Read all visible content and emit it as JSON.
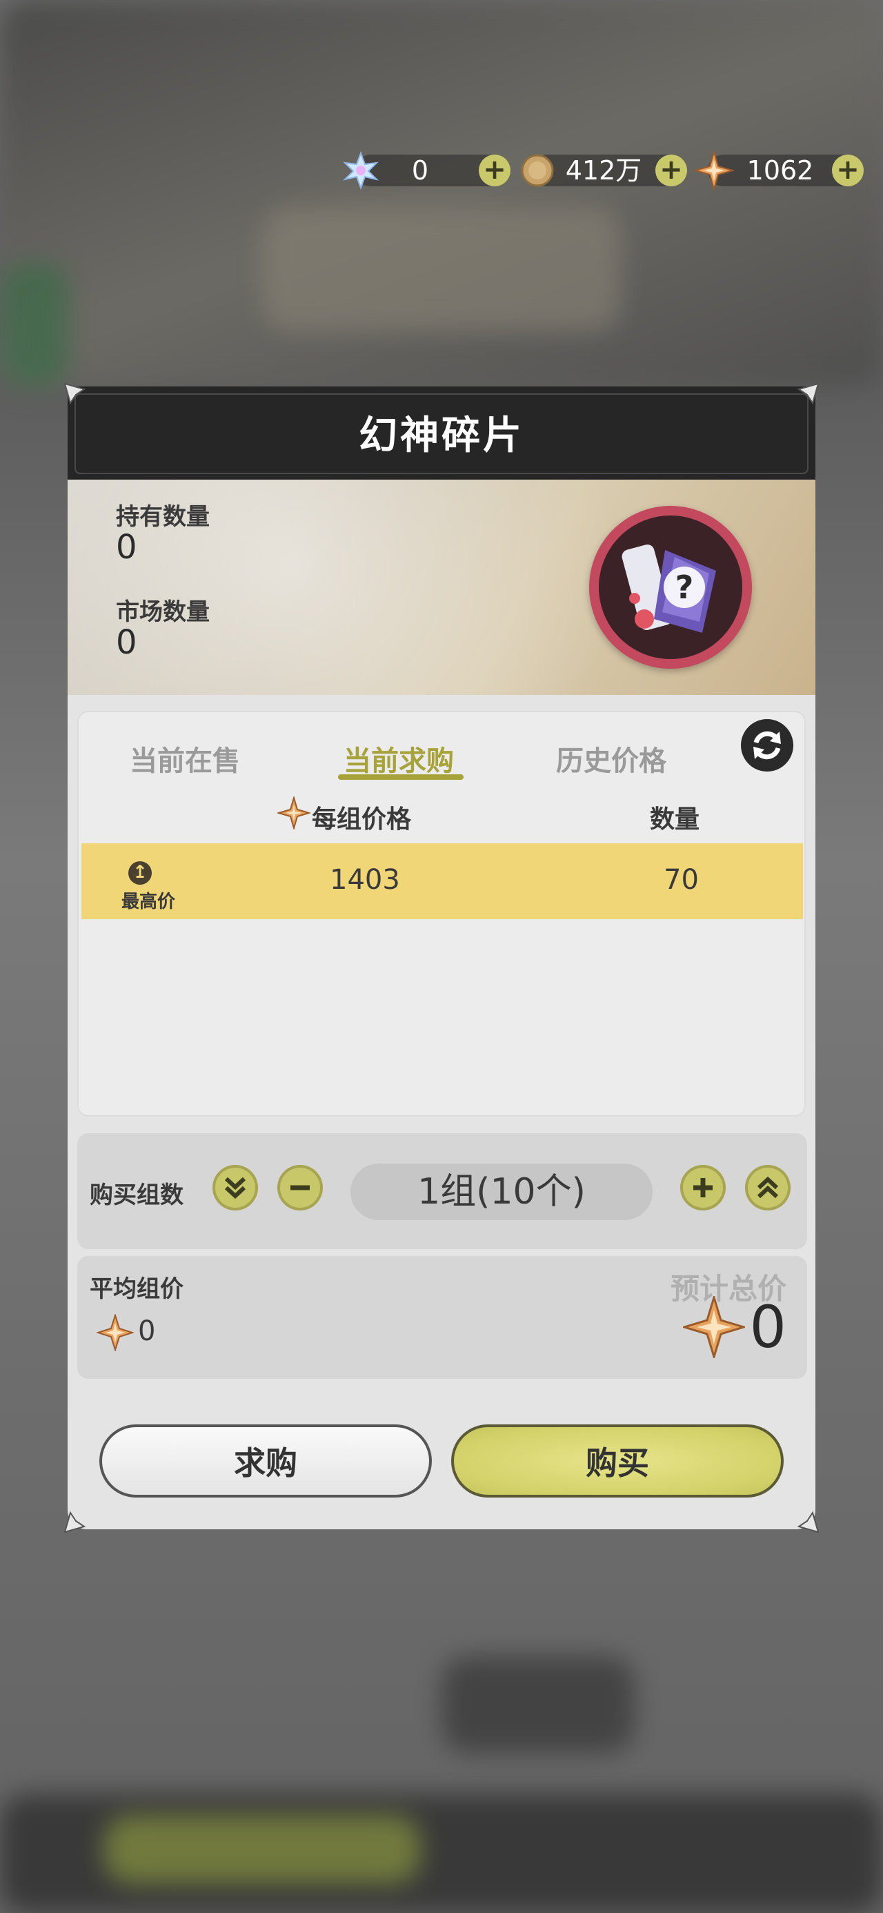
{
  "currencies": [
    {
      "name": "crystal-icon",
      "value": "0"
    },
    {
      "name": "coin-icon",
      "value": "412万"
    },
    {
      "name": "star-gem-icon",
      "value": "1062"
    }
  ],
  "dialog": {
    "title": "幻神碎片",
    "held_label": "持有数量",
    "held_value": "0",
    "market_label": "市场数量",
    "market_value": "0"
  },
  "tabs": [
    "当前在售",
    "当前求购",
    "历史价格"
  ],
  "active_tab": "当前求购",
  "table": {
    "col_price": "每组价格",
    "col_qty": "数量",
    "rows": [
      {
        "badge_label": "最高价",
        "price": "1403",
        "qty": "70"
      }
    ]
  },
  "quantity": {
    "label": "购买组数",
    "value": "1组(10个)"
  },
  "totals": {
    "avg_label": "平均组价",
    "avg_value": "0",
    "est_label": "预计总价",
    "est_value": "0"
  },
  "buttons": {
    "request": "求购",
    "buy": "购买"
  },
  "colors": {
    "accent": "#a8a23a",
    "row_highlight": "#f1d678",
    "button_green": "#d4d26a"
  }
}
